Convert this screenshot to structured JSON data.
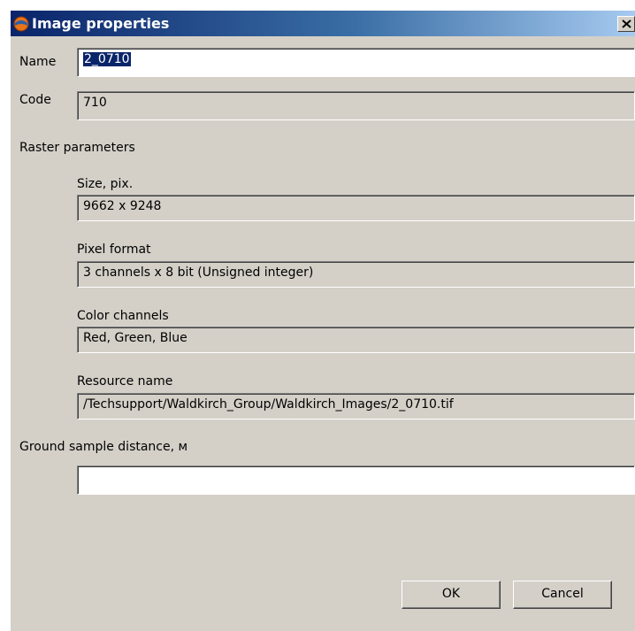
{
  "window": {
    "title": "Image properties",
    "close_glyph": "✕"
  },
  "name": {
    "label": "Name",
    "value": "2_0710"
  },
  "code": {
    "label": "Code",
    "value": "710"
  },
  "raster": {
    "heading": "Raster parameters",
    "size": {
      "label": "Size, pix.",
      "value": "9662 x 9248"
    },
    "pixel_format": {
      "label": "Pixel format",
      "value": "3 channels x 8 bit (Unsigned integer)"
    },
    "color_channels": {
      "label": "Color channels",
      "value": "Red, Green, Blue"
    },
    "resource_name": {
      "label": "Resource name",
      "value": "/Techsupport/Waldkirch_Group/Waldkirch_Images/2_0710.tif"
    }
  },
  "gsd": {
    "label": "Ground sample distance, м",
    "value": ""
  },
  "buttons": {
    "ok": "OK",
    "cancel": "Cancel"
  },
  "colors": {
    "dialog_bg": "#d4d0c8",
    "titlebar_start": "#0a246a",
    "titlebar_end": "#a6caf0",
    "selection": "#0a246a"
  },
  "icons": {
    "app": "app-icon",
    "close": "close-icon"
  }
}
